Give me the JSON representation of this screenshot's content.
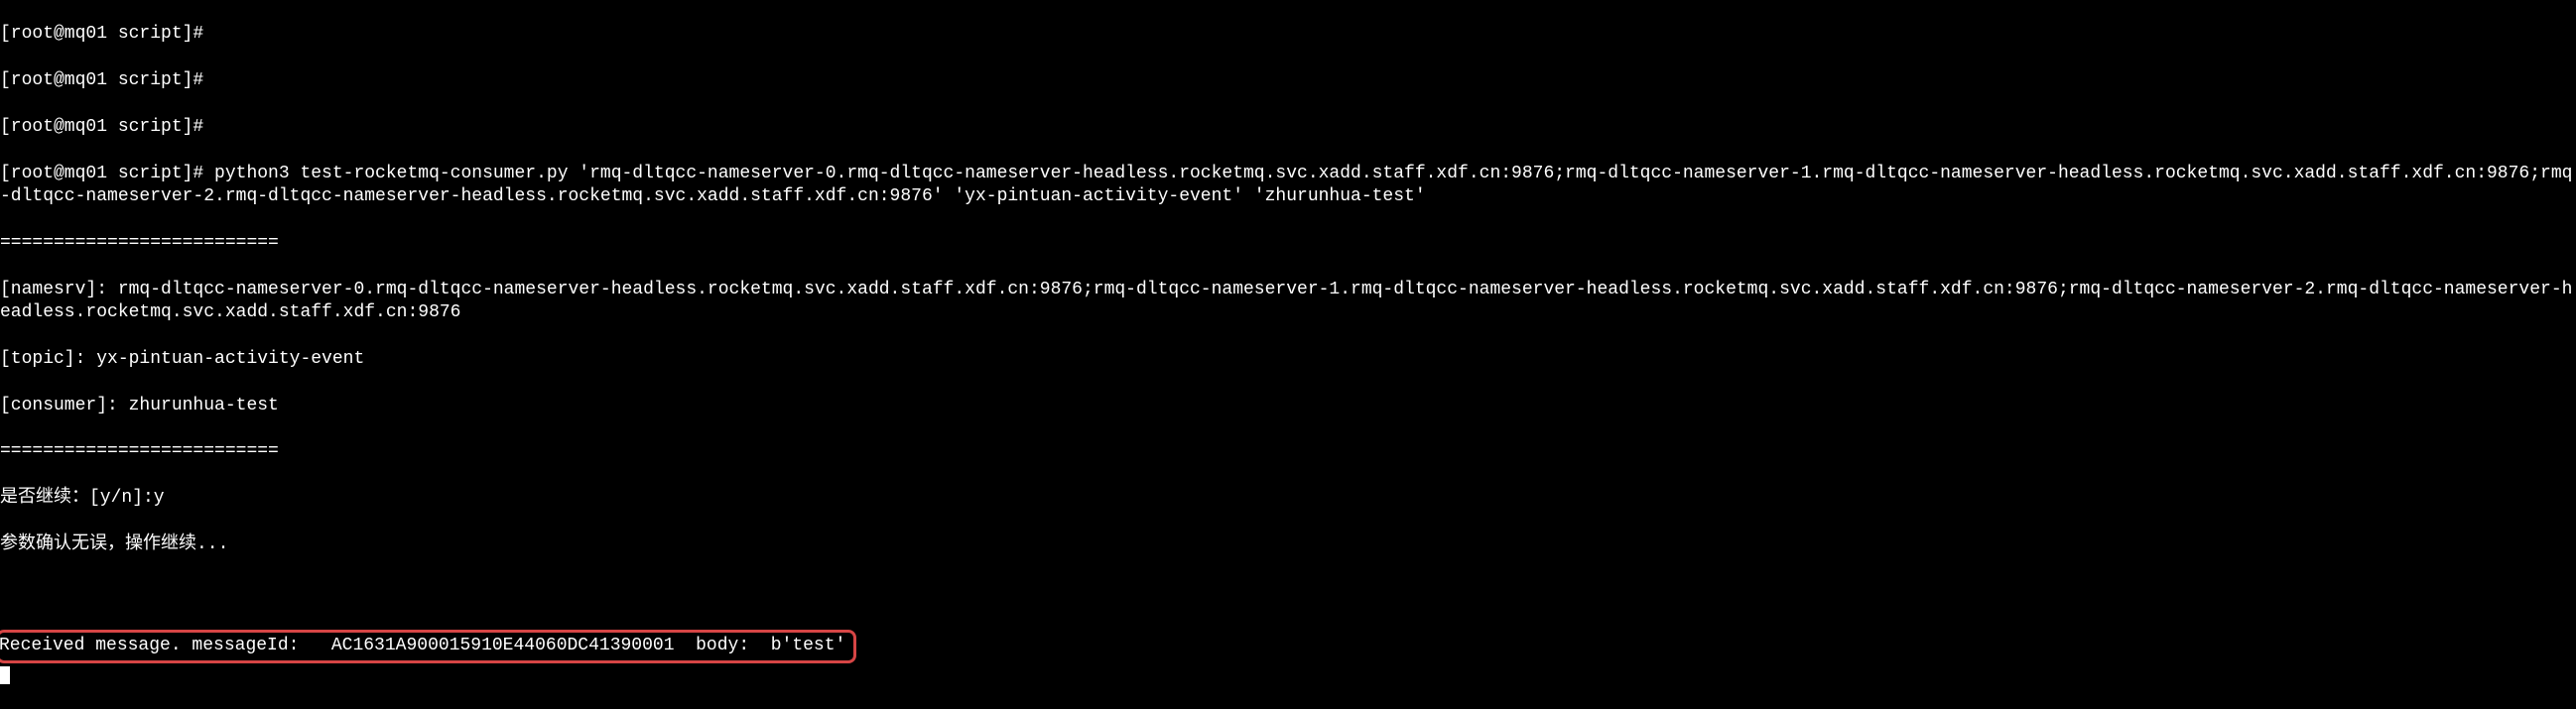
{
  "terminal": {
    "prompt1": "[root@mq01 script]#",
    "prompt2": "[root@mq01 script]#",
    "prompt3": "[root@mq01 script]#",
    "prompt4": "[root@mq01 script]# python3 test-rocketmq-consumer.py 'rmq-dltqcc-nameserver-0.rmq-dltqcc-nameserver-headless.rocketmq.svc.xadd.staff.xdf.cn:9876;rmq-dltqcc-nameserver-1.rmq-dltqcc-nameserver-headless.rocketmq.svc.xadd.staff.xdf.cn:9876;rmq-dltqcc-nameserver-2.rmq-dltqcc-nameserver-headless.rocketmq.svc.xadd.staff.xdf.cn:9876' 'yx-pintuan-activity-event' 'zhurunhua-test'",
    "separator1": "==========================",
    "namesrv_line": "[namesrv]: rmq-dltqcc-nameserver-0.rmq-dltqcc-nameserver-headless.rocketmq.svc.xadd.staff.xdf.cn:9876;rmq-dltqcc-nameserver-1.rmq-dltqcc-nameserver-headless.rocketmq.svc.xadd.staff.xdf.cn:9876;rmq-dltqcc-nameserver-2.rmq-dltqcc-nameserver-headless.rocketmq.svc.xadd.staff.xdf.cn:9876",
    "topic_line": "[topic]: yx-pintuan-activity-event",
    "consumer_line": "[consumer]: zhurunhua-test",
    "separator2": "==========================",
    "confirm_prompt": "是否继续：[y/n]:y",
    "confirm_msg": "参数确认无误，操作继续...",
    "received_msg": "Received message. messageId:   AC1631A900015910E44060DC41390001  body:  b'test'"
  }
}
